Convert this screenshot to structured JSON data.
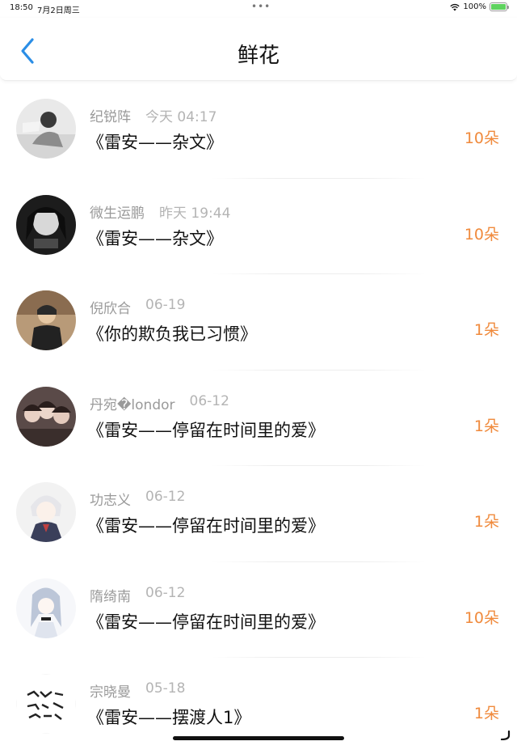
{
  "status_bar": {
    "time": "18:50",
    "date": "7月2日周三",
    "battery": "100%"
  },
  "nav": {
    "title": "鲜花"
  },
  "rows": [
    {
      "user": "纪锐阵",
      "time": "今天 04:17",
      "book": "《雷安——杂文》",
      "count": "10朵"
    },
    {
      "user": "微生运鹏",
      "time": "昨天 19:44",
      "book": "《雷安——杂文》",
      "count": "10朵"
    },
    {
      "user": "倪欣合",
      "time": "06-19",
      "book": "《你的欺负我已习惯》",
      "count": "1朵"
    },
    {
      "user": "丹宛�londor",
      "time": "06-12",
      "book": "《雷安——停留在时间里的爱》",
      "count": "1朵"
    },
    {
      "user": "功志义",
      "time": "06-12",
      "book": "《雷安——停留在时间里的爱》",
      "count": "1朵"
    },
    {
      "user": "隋绮南",
      "time": "06-12",
      "book": "《雷安——停留在时间里的爱》",
      "count": "10朵"
    },
    {
      "user": "宗晓曼",
      "time": "05-18",
      "book": "《雷安——摆渡人1》",
      "count": "1朵"
    }
  ],
  "colors": {
    "accent": "#2b8ee6",
    "count": "#f08a3c",
    "meta": "#9a9a9a"
  }
}
